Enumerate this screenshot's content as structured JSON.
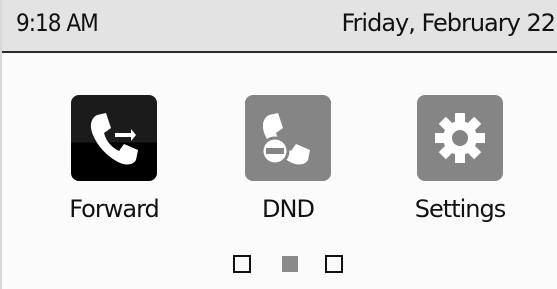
{
  "status_bar": {
    "time": "9:18 AM",
    "date": "Friday, February 22"
  },
  "apps": [
    {
      "label": "Forward",
      "icon": "call-forward-icon",
      "tile_color": "#000000"
    },
    {
      "label": "DND",
      "icon": "do-not-disturb-icon",
      "tile_color": "#858585"
    },
    {
      "label": "Settings",
      "icon": "gear-icon",
      "tile_color": "#858585"
    }
  ],
  "page_indicator": {
    "pages": 3,
    "current_page": 2
  },
  "colors": {
    "status_bar_bg": "#e3e3e3",
    "screen_bg": "#fbfbfb",
    "active_dot": "#8a8a8a"
  }
}
